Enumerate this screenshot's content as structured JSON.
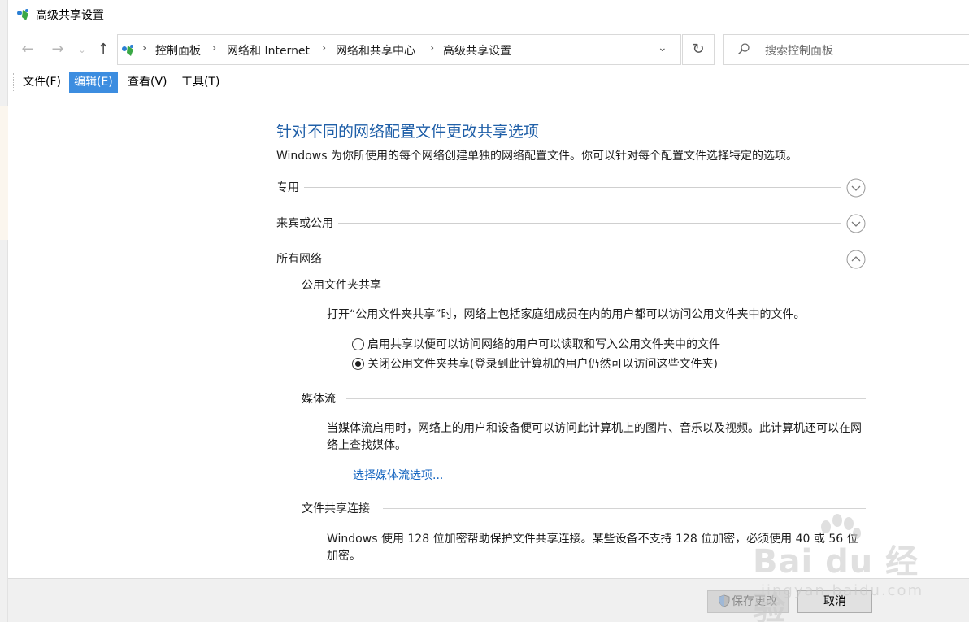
{
  "window": {
    "title": "高级共享设置"
  },
  "nav": {
    "back": "←",
    "forward": "→",
    "history": "⌄",
    "up": "↑"
  },
  "address": {
    "crumbs": [
      "控制面板",
      "网络和 Internet",
      "网络和共享中心",
      "高级共享设置"
    ],
    "separator": "›",
    "dropdown": "⌄",
    "refresh": "↻"
  },
  "search": {
    "placeholder": "搜索控制面板"
  },
  "menu": {
    "file": "文件(F)",
    "edit": "编辑(E)",
    "view": "查看(V)",
    "tools": "工具(T)"
  },
  "main": {
    "heading": "针对不同的网络配置文件更改共享选项",
    "intro": "Windows 为你所使用的每个网络创建单独的网络配置文件。你可以针对每个配置文件选择特定的选项。",
    "profiles": [
      {
        "label": "专用",
        "state": "collapsed"
      },
      {
        "label": "来宾或公用",
        "state": "collapsed"
      },
      {
        "label": "所有网络",
        "state": "expanded"
      }
    ],
    "public_folder": {
      "title": "公用文件夹共享",
      "desc": "打开“公用文件夹共享”时，网络上包括家庭组成员在内的用户都可以访问公用文件夹中的文件。",
      "options": [
        {
          "label": "启用共享以便可以访问网络的用户可以读取和写入公用文件夹中的文件",
          "checked": false
        },
        {
          "label": "关闭公用文件夹共享(登录到此计算机的用户仍然可以访问这些文件夹)",
          "checked": true
        }
      ]
    },
    "media": {
      "title": "媒体流",
      "desc": "当媒体流启用时，网络上的用户和设备便可以访问此计算机上的图片、音乐以及视频。此计算机还可以在网络上查找媒体。",
      "link": "选择媒体流选项..."
    },
    "file_conn": {
      "title": "文件共享连接",
      "desc": "Windows 使用 128 位加密帮助保护文件共享连接。某些设备不支持 128 位加密，必须使用 40 或 56 位加密。"
    }
  },
  "footer": {
    "save": "保存更改",
    "cancel": "取消"
  },
  "watermark": {
    "brand": "Bai du 经验",
    "url": "jingyan.baidu.com"
  },
  "colors": {
    "heading": "#1f5fa8",
    "link": "#1565c0",
    "menu_active": "#3c8de0"
  }
}
